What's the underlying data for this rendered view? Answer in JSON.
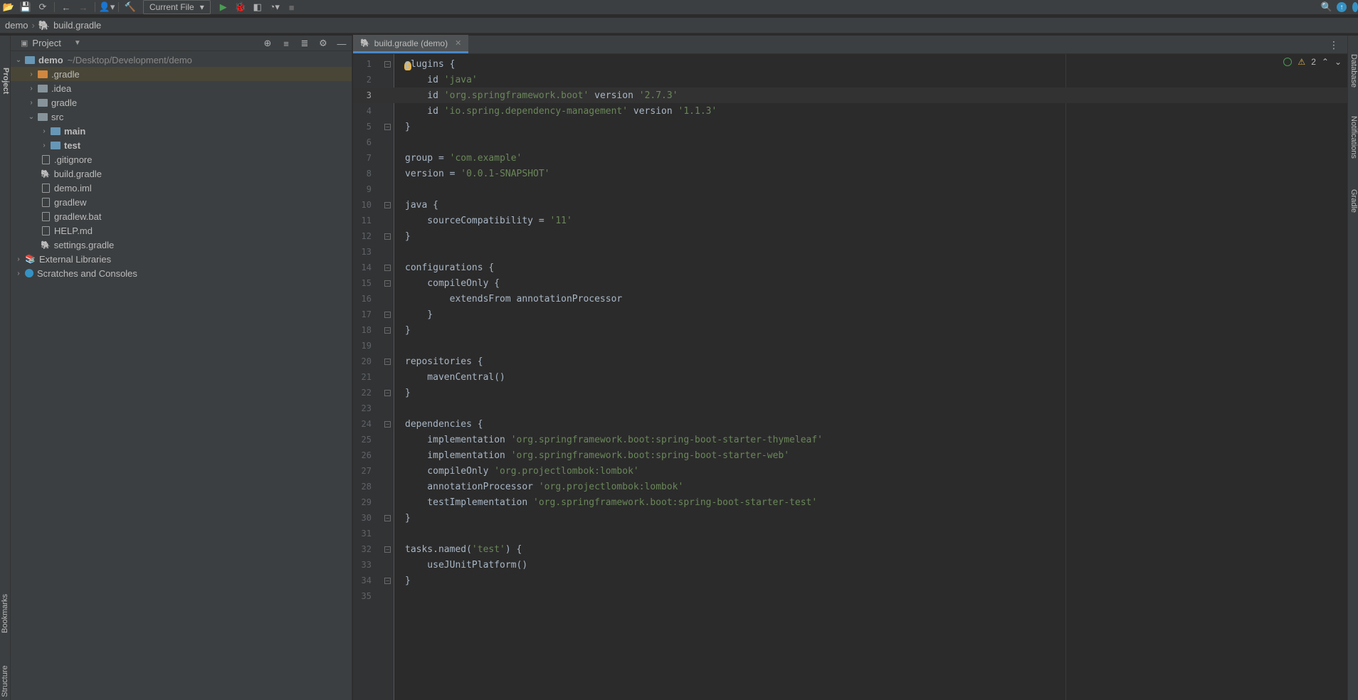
{
  "toolbar": {
    "run_config": "Current File"
  },
  "breadcrumb": {
    "project": "demo",
    "file": "build.gradle"
  },
  "left_stripe": {
    "project_label": "Project",
    "bookmarks_label": "Bookmarks",
    "structure_label": "Structure"
  },
  "right_stripe": {
    "database_label": "Database",
    "notifications_label": "Notifications",
    "gradle_label": "Gradle"
  },
  "project_panel": {
    "title": "Project",
    "tree": [
      {
        "label": "demo",
        "path": "~/Desktop/Development/demo"
      },
      {
        "label": ".gradle"
      },
      {
        "label": ".idea"
      },
      {
        "label": "gradle"
      },
      {
        "label": "src"
      },
      {
        "label": "main"
      },
      {
        "label": "test"
      },
      {
        "label": ".gitignore"
      },
      {
        "label": "build.gradle"
      },
      {
        "label": "demo.iml"
      },
      {
        "label": "gradlew"
      },
      {
        "label": "gradlew.bat"
      },
      {
        "label": "HELP.md"
      },
      {
        "label": "settings.gradle"
      },
      {
        "label": "External Libraries"
      },
      {
        "label": "Scratches and Consoles"
      }
    ]
  },
  "editor": {
    "tab_label": "build.gradle (demo)",
    "warning_count": "2",
    "current_line": 3,
    "lines": [
      "plugins {",
      "    id 'java'",
      "    id 'org.springframework.boot' version '2.7.3'",
      "    id 'io.spring.dependency-management' version '1.1.3'",
      "}",
      "",
      "group = 'com.example'",
      "version = '0.0.1-SNAPSHOT'",
      "",
      "java {",
      "    sourceCompatibility = '11'",
      "}",
      "",
      "configurations {",
      "    compileOnly {",
      "        extendsFrom annotationProcessor",
      "    }",
      "}",
      "",
      "repositories {",
      "    mavenCentral()",
      "}",
      "",
      "dependencies {",
      "    implementation 'org.springframework.boot:spring-boot-starter-thymeleaf'",
      "    implementation 'org.springframework.boot:spring-boot-starter-web'",
      "    compileOnly 'org.projectlombok:lombok'",
      "    annotationProcessor 'org.projectlombok:lombok'",
      "    testImplementation 'org.springframework.boot:spring-boot-starter-test'",
      "}",
      "",
      "tasks.named('test') {",
      "    useJUnitPlatform()",
      "}",
      ""
    ]
  }
}
